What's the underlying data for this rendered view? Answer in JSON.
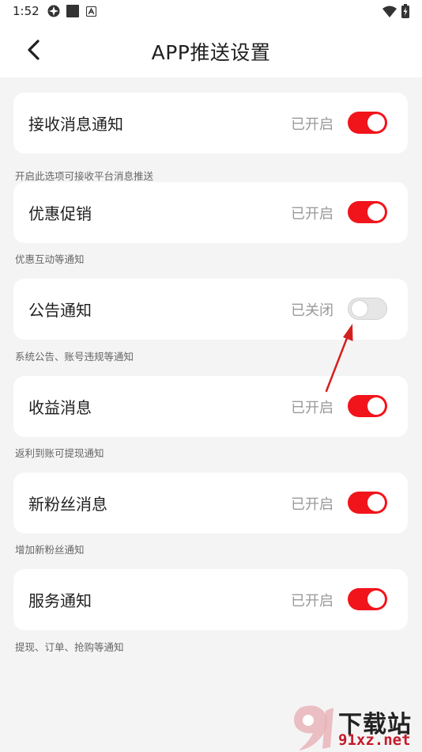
{
  "status_bar": {
    "time": "1:52"
  },
  "header": {
    "title": "APP推送设置"
  },
  "settings": [
    {
      "label": "接收消息通知",
      "status": "已开启",
      "on": true,
      "hint": "开启此选项可接收平台消息推送"
    },
    {
      "label": "优惠促销",
      "status": "已开启",
      "on": true,
      "hint": "优惠互动等通知"
    },
    {
      "label": "公告通知",
      "status": "已关闭",
      "on": false,
      "hint": "系统公告、账号违规等通知"
    },
    {
      "label": "收益消息",
      "status": "已开启",
      "on": true,
      "hint": "返利到账可提现通知"
    },
    {
      "label": "新粉丝消息",
      "status": "已开启",
      "on": true,
      "hint": "增加新粉丝通知"
    },
    {
      "label": "服务通知",
      "status": "已开启",
      "on": true,
      "hint": "提现、订单、抢购等通知"
    }
  ],
  "watermark": {
    "line1": "下载站",
    "line2": "91xz.net"
  },
  "colors": {
    "accent": "#f2141b",
    "toggle_off": "#e6e6e6",
    "background": "#f4f4f4"
  }
}
